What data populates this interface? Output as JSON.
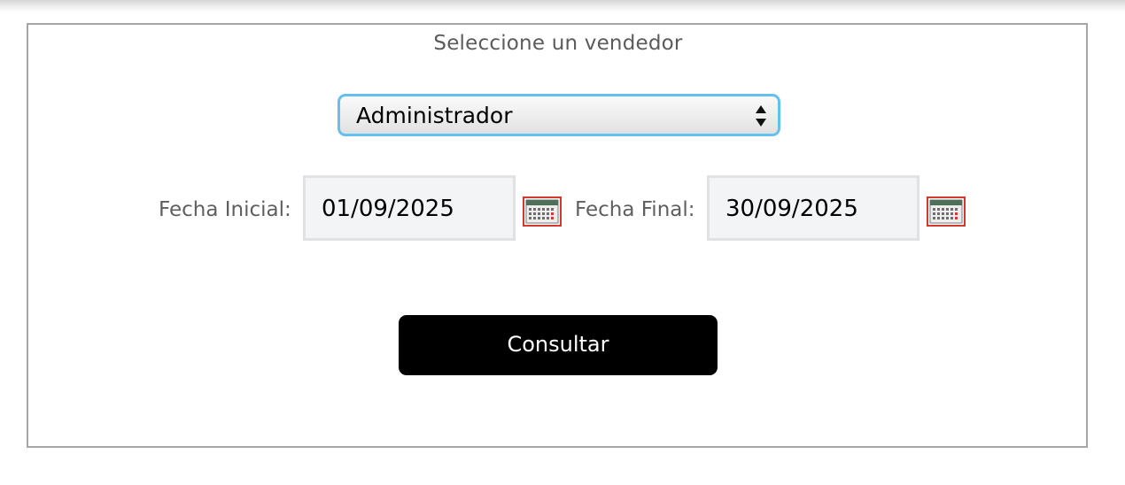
{
  "form": {
    "title": "Seleccione un vendedor",
    "vendor_select": {
      "selected": "Administrador"
    },
    "start_date": {
      "label": "Fecha Inicial:",
      "value": "01/09/2025"
    },
    "end_date": {
      "label": "Fecha Final:",
      "value": "30/09/2025"
    },
    "submit_label": "Consultar"
  },
  "icons": {
    "select_arrows": "up-down-arrows-icon",
    "start_calendar": "calendar-icon",
    "end_calendar": "calendar-icon"
  },
  "colors": {
    "select_focus_border": "#63c0ef",
    "button_background": "#000000",
    "button_text": "#ffffff",
    "input_background": "#f3f4f6",
    "calendar_border": "#d33a2c"
  }
}
